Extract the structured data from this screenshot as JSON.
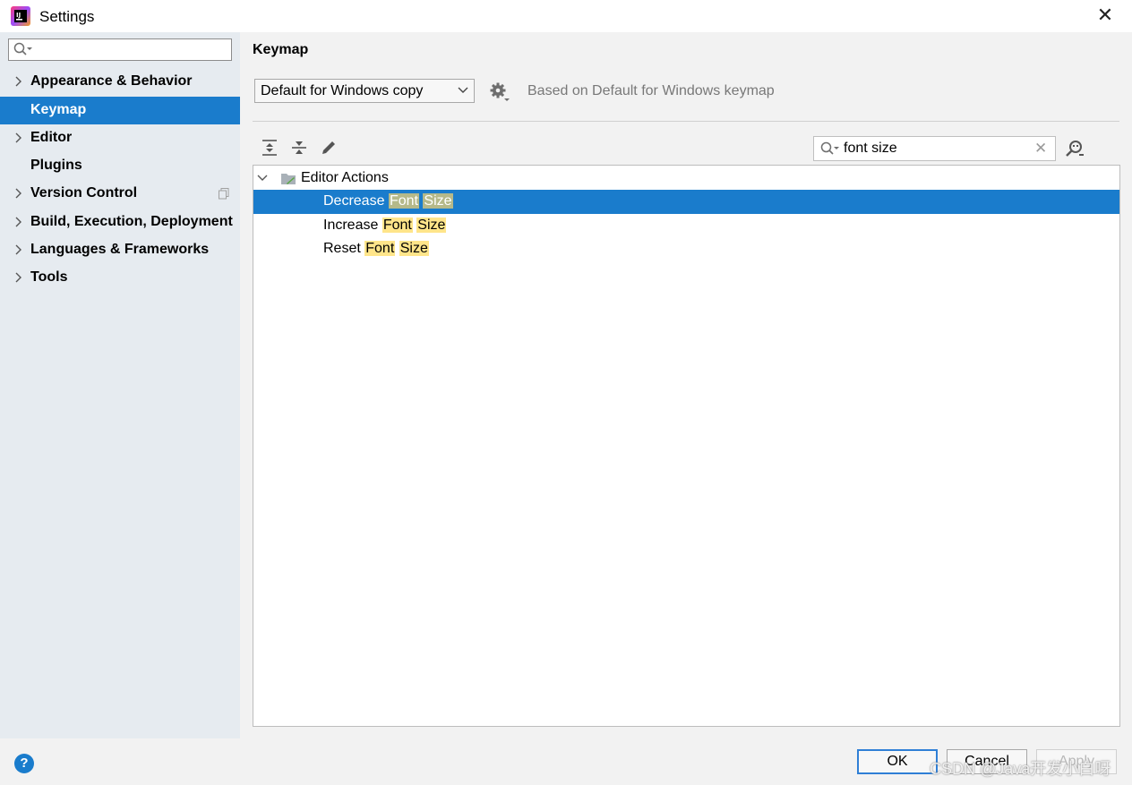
{
  "window": {
    "title": "Settings"
  },
  "sidebar": {
    "search_value": "",
    "items": [
      {
        "label": "Appearance & Behavior",
        "expandable": true,
        "selected": false
      },
      {
        "label": "Keymap",
        "expandable": false,
        "selected": true
      },
      {
        "label": "Editor",
        "expandable": true,
        "selected": false
      },
      {
        "label": "Plugins",
        "expandable": false,
        "selected": false
      },
      {
        "label": "Version Control",
        "expandable": true,
        "selected": false
      },
      {
        "label": "Build, Execution, Deployment",
        "expandable": true,
        "selected": false
      },
      {
        "label": "Languages & Frameworks",
        "expandable": true,
        "selected": false
      },
      {
        "label": "Tools",
        "expandable": true,
        "selected": false
      }
    ]
  },
  "main": {
    "title": "Keymap",
    "keymap_select": "Default for Windows copy",
    "based_on": "Based on Default for Windows keymap",
    "filter_value": "font size",
    "tree": {
      "group": "Editor Actions",
      "actions": [
        {
          "prefix": "Decrease",
          "match1": "Font",
          "match2": "Size",
          "selected": true
        },
        {
          "prefix": "Increase",
          "match1": "Font",
          "match2": "Size",
          "selected": false
        },
        {
          "prefix": "Reset",
          "match1": "Font",
          "match2": "Size",
          "selected": false
        }
      ]
    }
  },
  "buttons": {
    "ok": "OK",
    "cancel": "Cancel",
    "apply": "Apply",
    "help": "?"
  },
  "watermark": "CSDN @Java开发小白呀",
  "colors": {
    "accent": "#1a7ccc",
    "highlight": "#ffe58a",
    "sidebar_bg": "#e6ebf0"
  }
}
